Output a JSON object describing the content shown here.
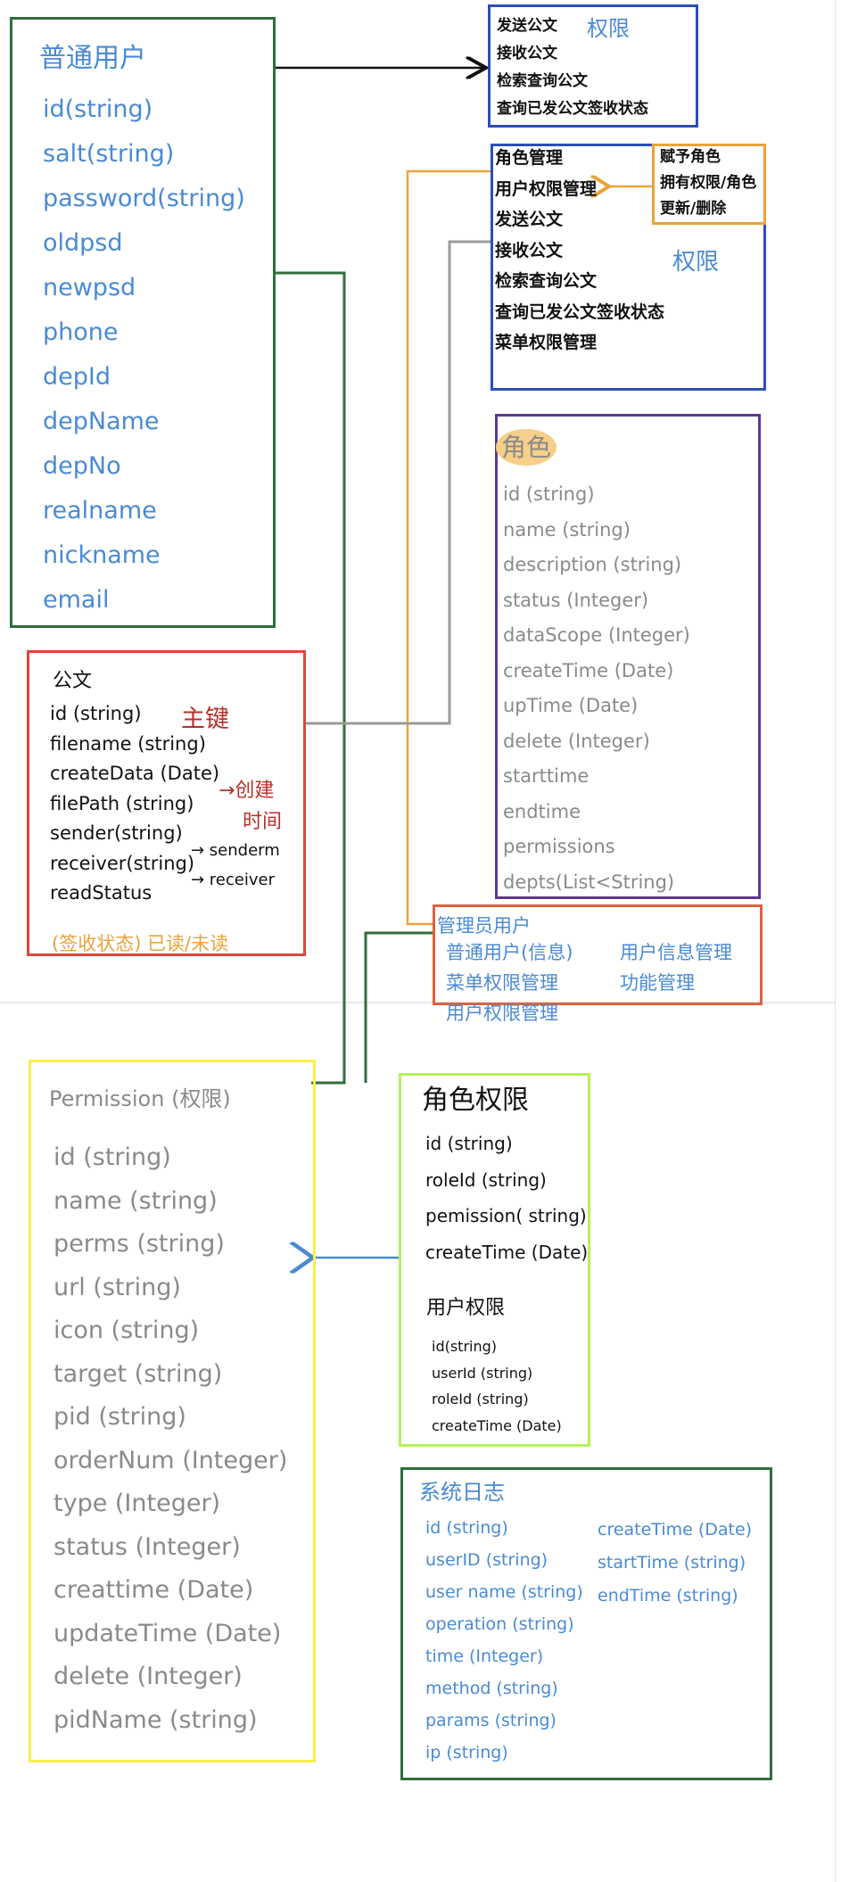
{
  "colors": {
    "blue_text": "#4a8ad4",
    "gray_text": "#8a8a8a",
    "black_text": "#111111",
    "red_note": "#b8302a",
    "orange_note": "#eba33a"
  },
  "user": {
    "title": "普通用户",
    "fields": [
      "id(string)",
      "salt(string)",
      "password(string)",
      "oldpsd",
      "newpsd",
      "phone",
      "depId",
      "depName",
      "depNo",
      "realname",
      "nickname",
      "email"
    ]
  },
  "perm_top": {
    "items": [
      "发送公文",
      "接收公文",
      "检索查询公文",
      "查询已发公文签收状态"
    ],
    "label": "权限"
  },
  "perm_main": {
    "items": [
      "角色管理",
      "用户权限管理",
      "发送公文",
      "接收公文",
      "检索查询公文",
      "查询已发公文签收状态",
      "菜单权限管理"
    ],
    "label": "权限",
    "sub": [
      "赋予角色",
      "拥有权限/角色",
      "更新/删除"
    ]
  },
  "role": {
    "title": "角色",
    "fields": [
      "id (string)",
      "name (string)",
      "description (string)",
      "status (Integer)",
      "dataScope (Integer)",
      "createTime (Date)",
      "upTime (Date)",
      "delete (Integer)",
      "starttime",
      "endtime",
      "permissions",
      "depts(List<String)"
    ]
  },
  "doc": {
    "title": "公文",
    "fields": [
      "id (string)",
      "filename (string)",
      "createData (Date)",
      "filePath (string)",
      "sender(string)",
      "receiver(string)",
      "readStatus"
    ],
    "notes": {
      "pk": "主键",
      "create1": "→创建",
      "create2": "时间",
      "sender": "→ senderm",
      "receiver": "→ receiver",
      "status": "(签收状态) 已读/未读"
    }
  },
  "admin": {
    "title": "管理员用户",
    "left": [
      "普通用户(信息)",
      "菜单权限管理",
      "用户权限管理"
    ],
    "right": [
      "用户信息管理",
      "功能管理"
    ]
  },
  "permission": {
    "title": "Permission (权限)",
    "fields": [
      "id (string)",
      "name (string)",
      "perms (string)",
      "url (string)",
      "icon (string)",
      "target (string)",
      "pid (string)",
      "orderNum (Integer)",
      "type (Integer)",
      "status (Integer)",
      "creattime (Date)",
      "updateTime (Date)",
      "delete (Integer)",
      "pidName (string)"
    ]
  },
  "role_perm": {
    "title": "角色权限",
    "fields": [
      "id (string)",
      "roleId (string)",
      "pemission( string)",
      "createTime (Date)"
    ],
    "user_title": "用户权限",
    "user_fields": [
      "id(string)",
      "userId (string)",
      "roleId (string)",
      "createTime (Date)"
    ]
  },
  "log": {
    "title": "系统日志",
    "left": [
      "id (string)",
      "userID (string)",
      "user name (string)",
      "operation (string)",
      "time (Integer)",
      "method (string)",
      "params (string)",
      "ip (string)"
    ],
    "right": [
      "createTime (Date)",
      "startTime (string)",
      "endTime (string)"
    ]
  }
}
